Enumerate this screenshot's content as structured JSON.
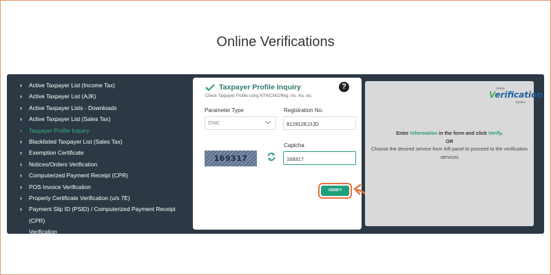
{
  "page": {
    "title": "Online Verifications"
  },
  "sidebar": {
    "items": [
      {
        "label": "Active Taxpayer List (Income Tax)",
        "active": false
      },
      {
        "label": "Active Taxpayer List (AJK)",
        "active": false
      },
      {
        "label": "Active Taxpayer Lists - Downloads",
        "active": false
      },
      {
        "label": "Active Taxpayer List (Sales Tax)",
        "active": false
      },
      {
        "label": "Taxpayer Profile Inquiry",
        "active": true
      },
      {
        "label": "Blacklisted Taxpayer List (Sales Tax)",
        "active": false
      },
      {
        "label": "Exemption Certificate",
        "active": false
      },
      {
        "label": "Notices/Orders Verification",
        "active": false
      },
      {
        "label": "Computerized Payment Receipt (CPR)",
        "active": false
      },
      {
        "label": "POS Invoice Verification",
        "active": false
      },
      {
        "label": "Property Certificate Verification (u/s 7E)",
        "active": false
      },
      {
        "label": "Payment Slip ID (PSID) / Computerized Payment Receipt (CPR)",
        "label2": "Verification",
        "active": false
      }
    ]
  },
  "form": {
    "title": "Taxpayer Profile Inquiry",
    "subtitle": "Check Taxpayer Profile using NTN/CNIC/Reg. Inc. No. etc.",
    "parameter_type_label": "Parameter Type",
    "parameter_type_value": "CNIC",
    "registration_label": "Registration No.",
    "registration_value": "812912EJJJD",
    "captcha_label": "Captcha",
    "captcha_image_text": "169317",
    "captcha_value": "169317",
    "verify_label": "VERIFY",
    "help_glyph": "?"
  },
  "info": {
    "logo_top": "Online",
    "logo_main_v": "V",
    "logo_main_rest": "erification",
    "logo_bottom": "System",
    "line1_pre": "Enter ",
    "line1_hl1": "Information",
    "line1_mid": " in the form and click ",
    "line1_hl2": "Verify",
    "line1_end": ".",
    "or": "OR",
    "line2": "Choose the desired service from left panel to proceed to the verification services"
  },
  "colors": {
    "panel_bg": "#2c3944",
    "accent_green": "#20a07d",
    "active_item": "#36b37e",
    "annotation_orange": "#e8703a"
  },
  "icons": [
    "chevron-right-icon",
    "check-icon",
    "help-icon",
    "chevron-down-icon",
    "refresh-icon",
    "curved-arrow-icon"
  ]
}
